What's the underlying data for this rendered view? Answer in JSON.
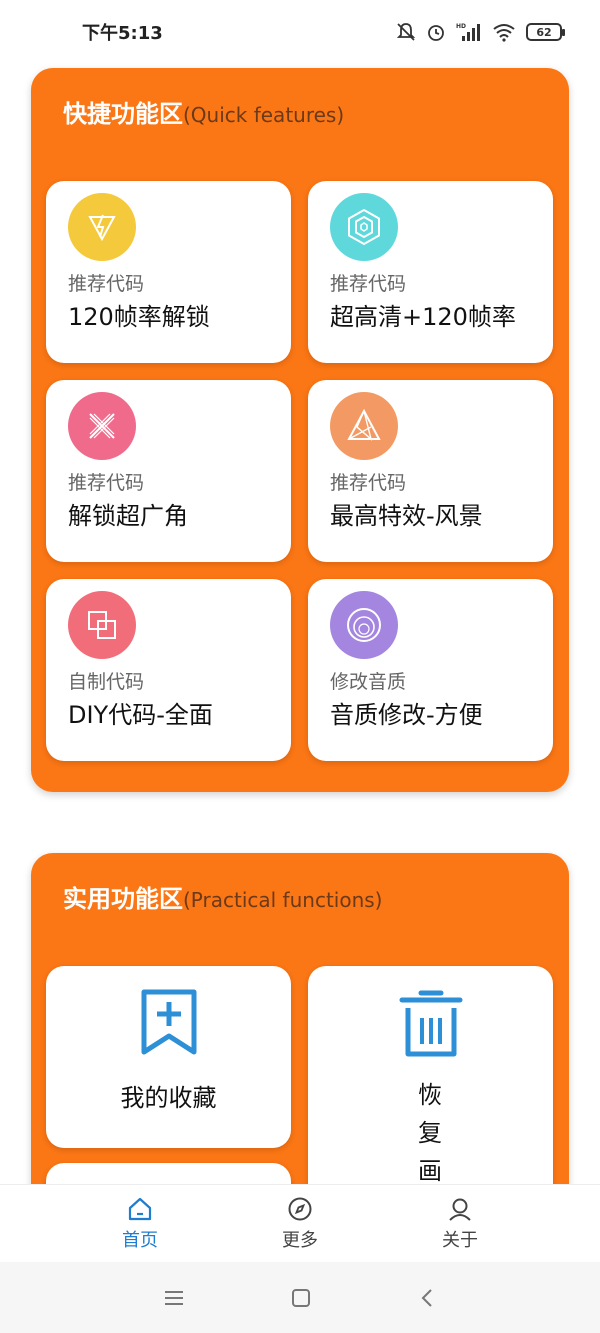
{
  "status": {
    "time": "下午5:13",
    "battery": "62",
    "icons": [
      "mute-bell-icon",
      "alarm-icon",
      "hd-signal-icon",
      "wifi-icon",
      "battery-icon"
    ]
  },
  "quick": {
    "title": "快捷功能区",
    "subtitle": "(Quick features)",
    "cards": [
      {
        "category": "推荐代码",
        "name": "120帧率解锁",
        "icon": "lightning-triangle-icon",
        "color": "#f5c93c"
      },
      {
        "category": "推荐代码",
        "name": "超高清+120帧率",
        "icon": "hexagon-icon",
        "color": "#5fd8dc"
      },
      {
        "category": "推荐代码",
        "name": "解锁超广角",
        "icon": "cross-lines-icon",
        "color": "#f06a8c"
      },
      {
        "category": "推荐代码",
        "name": "最高特效-风景",
        "icon": "mountain-triangle-icon",
        "color": "#f39a64"
      },
      {
        "category": "自制代码",
        "name": "DIY代码-全面",
        "icon": "overlap-squares-icon",
        "color": "#f16d7a"
      },
      {
        "category": "修改音质",
        "name": "音质修改-方便",
        "icon": "concentric-circles-icon",
        "color": "#a485e0"
      }
    ]
  },
  "practical": {
    "title": "实用功能区",
    "subtitle": "(Practical functions)",
    "cards": [
      {
        "label": "我的收藏",
        "icon": "bookmark-add-icon"
      },
      {
        "label": "恢复画",
        "icon": "trash-bin-icon"
      }
    ]
  },
  "nav": {
    "items": [
      {
        "label": "首页",
        "icon": "home-icon"
      },
      {
        "label": "更多",
        "icon": "compass-icon"
      },
      {
        "label": "关于",
        "icon": "user-icon"
      }
    ],
    "active_color": "#1f7dd0"
  },
  "system_nav": [
    "menu-icon",
    "home-square-icon",
    "back-icon"
  ]
}
